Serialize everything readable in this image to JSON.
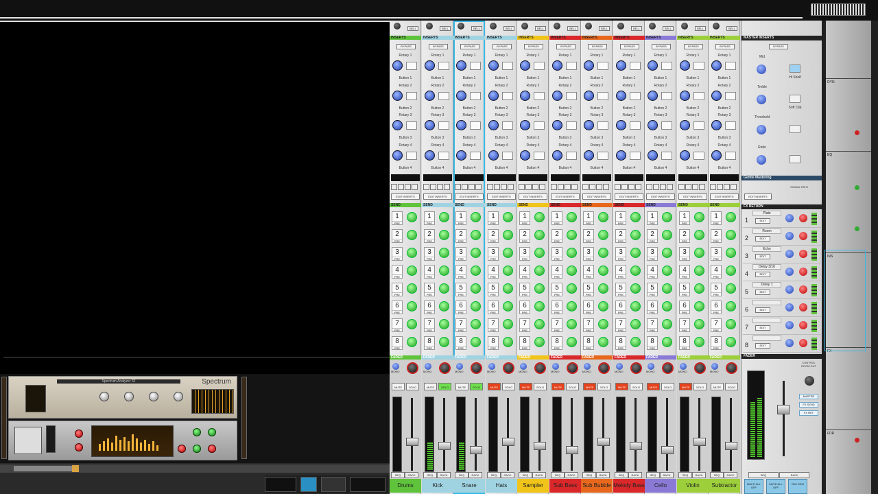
{
  "channels": [
    {
      "name": "Drums",
      "color": "#5fc33b",
      "muted": false,
      "soloed": false,
      "selected": false
    },
    {
      "name": "Kick",
      "color": "#9fd3e2",
      "muted": false,
      "soloed": true,
      "selected": false
    },
    {
      "name": "Snare",
      "color": "#9fd3e2",
      "muted": false,
      "soloed": true,
      "selected": true
    },
    {
      "name": "Hats",
      "color": "#9fd3e2",
      "muted": true,
      "soloed": false,
      "selected": false
    },
    {
      "name": "Sampler",
      "color": "#f0c419",
      "muted": true,
      "soloed": false,
      "selected": false
    },
    {
      "name": "Sub Bass",
      "color": "#d9272a",
      "muted": true,
      "soloed": false,
      "selected": false
    },
    {
      "name": "Sub Bubble",
      "color": "#e7671d",
      "muted": true,
      "soloed": false,
      "selected": false
    },
    {
      "name": "Melody Bass",
      "color": "#d9272a",
      "muted": true,
      "soloed": false,
      "selected": false
    },
    {
      "name": "Cello",
      "color": "#8a7ad6",
      "muted": true,
      "soloed": false,
      "selected": false
    },
    {
      "name": "Violin",
      "color": "#9ccf3a",
      "muted": true,
      "soloed": false,
      "selected": false
    },
    {
      "name": "Subtractor",
      "color": "#9ccf3a",
      "muted": false,
      "soloed": false,
      "selected": false
    }
  ],
  "strip": {
    "bell": "BELL",
    "inserts": "INSERTS",
    "bypass": "BYPASS",
    "rotary_labels": [
      "Rotary 1",
      "Rotary 2",
      "Rotary 3",
      "Rotary 4"
    ],
    "button_labels": [
      "Button 1",
      "Button 2",
      "Button 3",
      "Button 4"
    ],
    "edit_inserts": "EDIT INSERTS",
    "send": "SEND",
    "send_numbers": [
      "1",
      "2",
      "3",
      "4",
      "5",
      "6",
      "7",
      "8"
    ],
    "pre": "PRE",
    "fader": "FADER",
    "mono": "MONO",
    "mute": "MUTE",
    "solo": "SOLO",
    "seq": "SEQ",
    "rack": "RACK"
  },
  "master": {
    "master_inserts": "MASTER INSERTS",
    "bypass": "BYPASS",
    "knobs": [
      "Mid",
      "Treble",
      "Threshold",
      "Ratio"
    ],
    "buttons": [
      {
        "label": "Hi Shelf",
        "on": true
      },
      {
        "label": "Soft Clip",
        "on": false
      },
      {
        "label": "",
        "on": false
      },
      {
        "label": "",
        "on": false
      }
    ],
    "preset": "Gentle Mastering",
    "signal_path": "SIGNAL PATH",
    "fx_return": "FX RETURN",
    "fx_returns": [
      {
        "n": "1",
        "name": "Plate"
      },
      {
        "n": "2",
        "name": "Room"
      },
      {
        "n": "3",
        "name": "Echo"
      },
      {
        "n": "4",
        "name": "Delay 3/16"
      },
      {
        "n": "5",
        "name": "Delay 1"
      },
      {
        "n": "6",
        "name": ""
      },
      {
        "n": "7",
        "name": ""
      },
      {
        "n": "8",
        "name": ""
      }
    ],
    "edit": "EDIT",
    "fader": "FADER",
    "control_room_out": "CONTROL ROOM OUT",
    "master_btn": "MASTER",
    "fx_send": "FX SEND",
    "fx_ret": "FX RET",
    "peak": "PEAK",
    "mode": "MODE",
    "seq": "SEQ",
    "rack": "RACK",
    "bottom_tabs": [
      "MULTI ALL OFF",
      "MUTE ALL OFF",
      "DIM CRM"
    ]
  },
  "spectrum": {
    "brand": "Spectrum",
    "title": "Spectrum Analyzer 32"
  },
  "right_panel": {
    "sections": [
      "DYN",
      "EQ",
      "INS",
      "FX",
      "FDR"
    ]
  }
}
